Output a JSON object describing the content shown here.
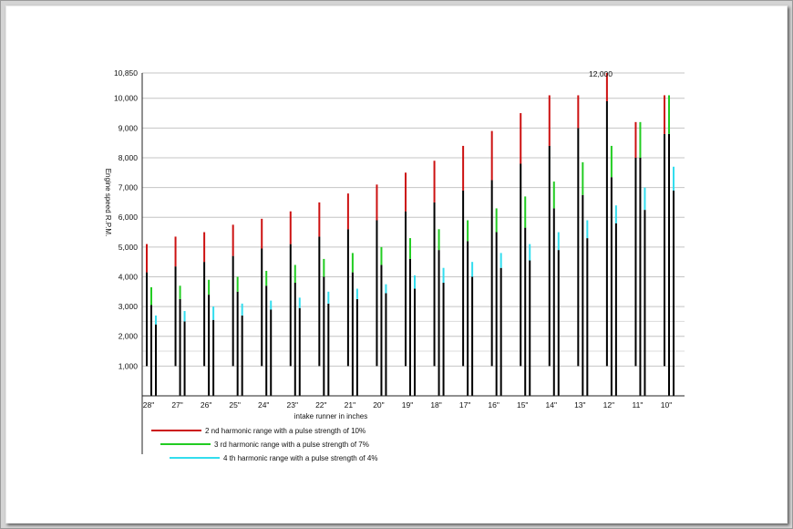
{
  "chart_data": {
    "type": "bar",
    "title": "",
    "xlabel": "intake runner in inches",
    "ylabel": "Engine speed  R.P.M.",
    "ylim": [
      0,
      10850
    ],
    "yticks": [
      {
        "value": 1000,
        "label": "1,000"
      },
      {
        "value": 2000,
        "label": "2,000"
      },
      {
        "value": 3000,
        "label": "3,000"
      },
      {
        "value": 4000,
        "label": "4,000"
      },
      {
        "value": 5000,
        "label": "5,000"
      },
      {
        "value": 6000,
        "label": "6,000"
      },
      {
        "value": 7000,
        "label": "7,000"
      },
      {
        "value": 8000,
        "label": "8,000"
      },
      {
        "value": 9000,
        "label": "9,000"
      },
      {
        "value": 10000,
        "label": "10,000"
      },
      {
        "value": 10850,
        "label": "10,850"
      }
    ],
    "annotation": "12,000",
    "grid": true,
    "legend_position": "bottom-left",
    "categories": [
      "28\"",
      "27\"",
      "26\"",
      "25\"",
      "24\"",
      "23\"",
      "22\"",
      "21\"",
      "20\"",
      "19\"",
      "18\"",
      "17\"",
      "16\"",
      "15\"",
      "14\"",
      "13\"",
      "12\"",
      "11\"",
      "10\""
    ],
    "series": [
      {
        "name": "2 nd harmonic range with a pulse strength of 10%",
        "color": "#cc1111",
        "low": [
          4150,
          4350,
          4500,
          4700,
          4950,
          5100,
          5350,
          5600,
          5900,
          6200,
          6500,
          6900,
          7250,
          7800,
          8400,
          9000,
          9900,
          8000,
          8800
        ],
        "high": [
          5100,
          5350,
          5500,
          5750,
          5950,
          6200,
          6500,
          6800,
          7100,
          7500,
          7900,
          8400,
          8900,
          9500,
          10100,
          10100,
          10850,
          9200,
          10100
        ]
      },
      {
        "name": "3 rd harmonic range with a pulse strength of 7%",
        "color": "#22cc22",
        "low": [
          3050,
          3250,
          3400,
          3500,
          3700,
          3800,
          4000,
          4150,
          4400,
          4600,
          4900,
          5200,
          5500,
          5650,
          6300,
          6750,
          7350,
          8000,
          8800
        ],
        "high": [
          3650,
          3700,
          3900,
          4000,
          4200,
          4400,
          4600,
          4800,
          5000,
          5300,
          5600,
          5900,
          6300,
          6700,
          7200,
          7850,
          8400,
          9200,
          10100
        ]
      },
      {
        "name": "4 th harmonic range with a pulse strength of 4%",
        "color": "#33ddee",
        "low": [
          2400,
          2500,
          2550,
          2700,
          2900,
          2950,
          3100,
          3250,
          3450,
          3600,
          3800,
          4000,
          4300,
          4550,
          4900,
          5300,
          5800,
          6250,
          6900
        ],
        "high": [
          2700,
          2850,
          3000,
          3100,
          3200,
          3300,
          3500,
          3600,
          3750,
          4050,
          4300,
          4500,
          4800,
          5100,
          5500,
          5900,
          6400,
          7000,
          7700
        ]
      }
    ],
    "black_base": [
      {
        "series": 0,
        "from": 1000
      },
      {
        "series": 1,
        "from": 0
      },
      {
        "series": 2,
        "from": 0
      }
    ]
  }
}
